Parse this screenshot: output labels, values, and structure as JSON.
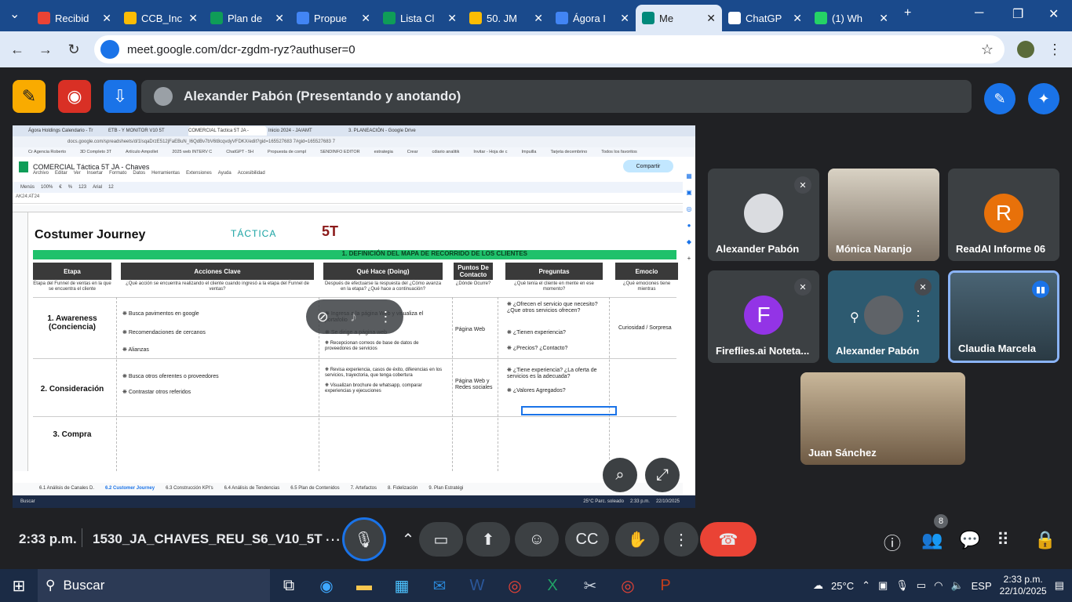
{
  "browser": {
    "tabs": [
      {
        "title": "Recibid",
        "icon": "gmail-icon",
        "color": "#ea4335"
      },
      {
        "title": "CCB_Inc",
        "icon": "drive-icon",
        "color": "#fbbc04"
      },
      {
        "title": "Plan de",
        "icon": "sheets-icon",
        "color": "#0f9d58"
      },
      {
        "title": "Propue",
        "icon": "docs-icon",
        "color": "#4285f4"
      },
      {
        "title": "Lista Cl",
        "icon": "sheets-icon",
        "color": "#0f9d58"
      },
      {
        "title": "50. JM",
        "icon": "drive-icon",
        "color": "#fbbc04"
      },
      {
        "title": "Ágora I",
        "icon": "docs-icon",
        "color": "#4285f4"
      },
      {
        "title": "Me",
        "icon": "meet-icon",
        "color": "#00897b"
      },
      {
        "title": "ChatGP",
        "icon": "chatgpt-icon",
        "color": "#ffffff"
      },
      {
        "title": "(1) Wh",
        "icon": "whatsapp-icon",
        "color": "#25d366"
      }
    ],
    "new_tab": "+",
    "url": "meet.google.com/dcr-zgdm-ryz?authuser=0"
  },
  "meet": {
    "presenter_label": "Alexander Pabón (Presentando y anotando)",
    "participants": [
      {
        "name": "Alexander Pabón",
        "initial": "",
        "muted": true
      },
      {
        "name": "Mónica Naranjo",
        "initial": "",
        "muted": false
      },
      {
        "name": "ReadAI Informe 06",
        "initial": "R",
        "muted": false
      },
      {
        "name": "Fireflies.ai Noteta...",
        "initial": "F",
        "muted": true
      },
      {
        "name": "Alexander Pabón",
        "initial": "",
        "muted": true
      },
      {
        "name": "Claudia Marcela",
        "initial": "",
        "muted": false
      },
      {
        "name": "Juan Sánchez",
        "initial": "",
        "muted": false
      }
    ],
    "time": "2:33 p.m.",
    "meeting_code": "1530_JA_CHAVES_REU_S6_V10_5T",
    "participant_count": "8",
    "colors": {
      "accent": "#1a73e8",
      "leave": "#ea4335",
      "panel": "#3c4043"
    }
  },
  "shared_screen": {
    "tabs": [
      "Ágora Holdings Calendario - Tr",
      "ETB - Y MONITOR V10 5T",
      "COMERCIAL Táctica 5T JA -",
      "Inicio 2024 - JA/AMT",
      "3. PLANEACIÓN - Google Drive"
    ],
    "address": "docs.google.com/spreadsheets/d/1IsqaDrzE512jFaEBuN_I6QdBv7bV6t8cqvdyVFDKX/edit?gid=165527683 7#gid=165527683 7",
    "bookmarks": [
      "Cr Agencia Roberto",
      "3D Completo 3T",
      "Artículo Ampollet",
      "2025 web INTERV C",
      "ChatGPT - 5H",
      "Propuesta de compl",
      "SENDINFO EDITOR",
      "estrategia",
      "Crear",
      "cdiario analitik",
      "Invitar - Hoja de c",
      "Impuilla",
      "Tarjeta decembrino",
      "Todos los favoritos"
    ],
    "doc_title": "COMERCIAL Táctica 5T JA - Chaves",
    "menu": [
      "Archivo",
      "Editar",
      "Ver",
      "Insertar",
      "Formato",
      "Datos",
      "Herramientas",
      "Extensiones",
      "Ayuda",
      "Accesibilidad"
    ],
    "share_label": "Compartir",
    "toolbar": [
      "Menús",
      "100%",
      "€",
      "%",
      "123",
      "Arial",
      "12"
    ],
    "cell_ref": "AK24:AT24",
    "sheet_tabs": [
      "6.1 Análisis de Canales D.",
      "6.2 Customer Journey",
      "6.3 Construcción KPI's",
      "6.4 Análisis de Tendencias",
      "6.5 Plan de Contenidos",
      "7. Artefactos",
      "8. Fidelización",
      "9. Plan Estratégi"
    ],
    "taskbar": {
      "search": "Buscar",
      "weather": "25°C Parc. soleado",
      "time": "2:33 p.m.",
      "date": "22/10/2025"
    },
    "sheet": {
      "title": "Costumer Journey",
      "brand": "TÁCTICA",
      "brand_logo": "5T",
      "section": "1. DEFINICIÓN DEL MAPA DE RECORRIDO DE LOS CLIENTES",
      "headers": [
        "Etapa",
        "Acciones Clave",
        "Qué Hace (Doing)",
        "Puntos De Contacto",
        "Preguntas",
        "Emocio"
      ],
      "subheaders": [
        "Etapa del Funnel de ventas en la que se encuentra el cliente",
        "¿Qué acción se encuentra realizando el cliente cuando ingresó a la etapa del Funnel de ventas?",
        "Después de efectuarse la respuesta del ¿Cómo avanza en la etapa? ¿Qué hace a continuación?",
        "¿Dónde Ocurre?",
        "¿Qué tenía el cliente en mente en ese momento?",
        "¿Qué emociones tiene mientras"
      ],
      "stages": [
        "1. Awareness (Conciencia)",
        "2. Consideración",
        "3. Compra"
      ],
      "acciones": [
        "Busca pavimentos en google",
        "Recomendaciones de cercanos",
        "Alianzas",
        "Busca otros oferentes o proveedores",
        "Contrastar otros referidos"
      ],
      "doing": [
        "Ingresa a la página Web y visualiza el portafolio",
        "Se dirige a página web",
        "Recepcionan correos de base de datos de proveedores de servicios",
        "Revisa experiencia, casos de éxito, diferencias en los servicios, trayectoria, que tenga cobertura",
        "Visualizan brochure de whatsapp, comparar experiencias y ejecuciones"
      ],
      "contacto": [
        "Página Web",
        "Página Web y Redes sociales"
      ],
      "preguntas": [
        "¿Ofrecen el servicio que necesito? ¿Que otros servicios ofrecen?",
        "¿Tienen experiencia?",
        "¿Precios? ¿Contacto?",
        "¿Tiene experiencia? ¿La oferta de servicios es la adecuada?",
        "¿Valores Agregados?"
      ],
      "emociones": [
        "Curiosidad / Sorpresa"
      ]
    }
  }
}
